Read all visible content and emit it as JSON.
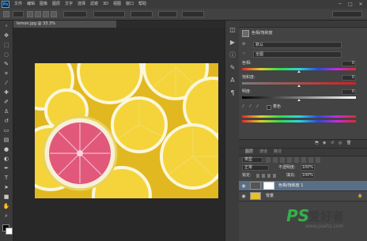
{
  "app": {
    "logo": "Ps"
  },
  "menu": [
    "文件",
    "编辑",
    "图像",
    "图层",
    "文字",
    "选择",
    "滤镜",
    "3D",
    "视图",
    "窗口",
    "帮助"
  ],
  "window_controls": [
    "─",
    "□",
    "✕"
  ],
  "options": {
    "preset_label": "预设"
  },
  "document": {
    "tab_title": "lemon.jpg @ 33.3%"
  },
  "properties": {
    "title": "色相/饱和度",
    "preset_value": "默认",
    "channel_value": "全图",
    "hue_label": "色相:",
    "hue_value": "0",
    "hue_slider_fraction": 0.5,
    "saturation_label": "饱和度:",
    "saturation_value": "0",
    "saturation_slider_fraction": 0.5,
    "lightness_label": "明度:",
    "lightness_value": "0",
    "lightness_slider_fraction": 0.5,
    "colorize_label": "着色"
  },
  "layers": {
    "tabs": [
      "图层",
      "通道",
      "路径"
    ],
    "filter_kind": "类型",
    "blend_mode": "正常",
    "opacity_label": "不透明度:",
    "opacity_value": "100%",
    "lock_label": "锁定:",
    "fill_label": "填充:",
    "fill_value": "100%",
    "items": [
      {
        "name": "色相/饱和度 1",
        "selected": true
      },
      {
        "name": "背景",
        "selected": false
      }
    ]
  },
  "watermark": {
    "brand": "PS",
    "text": "爱好者",
    "url": "www.psahz.com"
  },
  "colors": {
    "accent_blue": "#4aa3e8",
    "panel_bg": "#434343",
    "canvas_bg": "#282828",
    "selected_row": "#5a6e86"
  }
}
